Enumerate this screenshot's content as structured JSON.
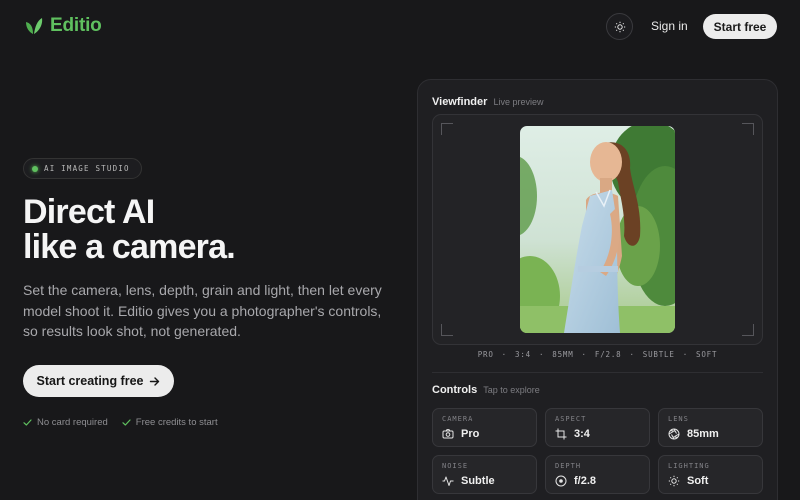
{
  "header": {
    "brand": "Editio",
    "sign_in": "Sign in",
    "start_free": "Start free",
    "accent": "#5fc05f"
  },
  "hero": {
    "badge": "AI IMAGE STUDIO",
    "headline_line1": "Direct AI",
    "headline_line2": "like a camera.",
    "subcopy": "Set the camera, lens, depth, grain and light, then let every model shoot it. Editio gives you a photographer's controls, so results look shot, not generated.",
    "cta": "Start creating free",
    "cta_icon": "arrow-right-icon",
    "notes": [
      "No card required",
      "Free credits to start"
    ]
  },
  "viewfinder": {
    "title": "Viewfinder",
    "subtitle": "Live preview",
    "readout": [
      "PRO",
      "3:4",
      "85MM",
      "F/2.8",
      "SUBTLE",
      "SOFT"
    ],
    "separator": "·"
  },
  "controls": {
    "title": "Controls",
    "subtitle": "Tap to explore",
    "items": [
      {
        "label": "CAMERA",
        "value": "Pro",
        "icon": "camera-icon"
      },
      {
        "label": "ASPECT",
        "value": "3:4",
        "icon": "crop-icon"
      },
      {
        "label": "LENS",
        "value": "85mm",
        "icon": "aperture-icon"
      },
      {
        "label": "NOISE",
        "value": "Subtle",
        "icon": "waveform-icon"
      },
      {
        "label": "DEPTH",
        "value": "f/2.8",
        "icon": "focus-circle-icon"
      },
      {
        "label": "LIGHTING",
        "value": "Soft",
        "icon": "sun-icon"
      }
    ]
  }
}
